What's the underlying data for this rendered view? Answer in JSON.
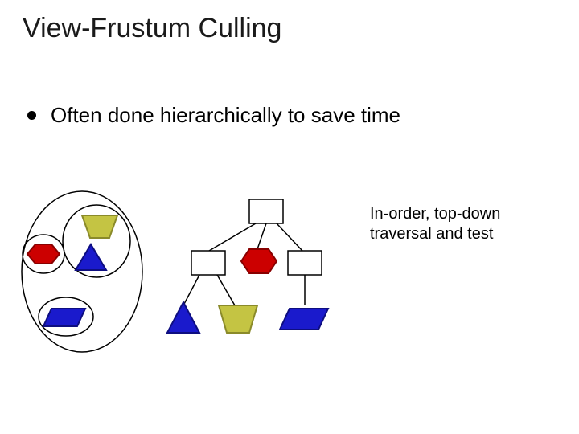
{
  "title": "View-Frustum Culling",
  "bullet": "Often done hierarchically to save time",
  "caption_line1": "In-order, top-down",
  "caption_line2": "traversal and test",
  "colors": {
    "olive_fill": "#c4c443",
    "olive_stroke": "#8a8a2a",
    "red_fill": "#cc0000",
    "red_stroke": "#880000",
    "blue_fill": "#1a1acc",
    "blue_stroke": "#0e0e80",
    "box_stroke": "#000000",
    "ellipse_stroke": "#000000",
    "line": "#000000"
  }
}
